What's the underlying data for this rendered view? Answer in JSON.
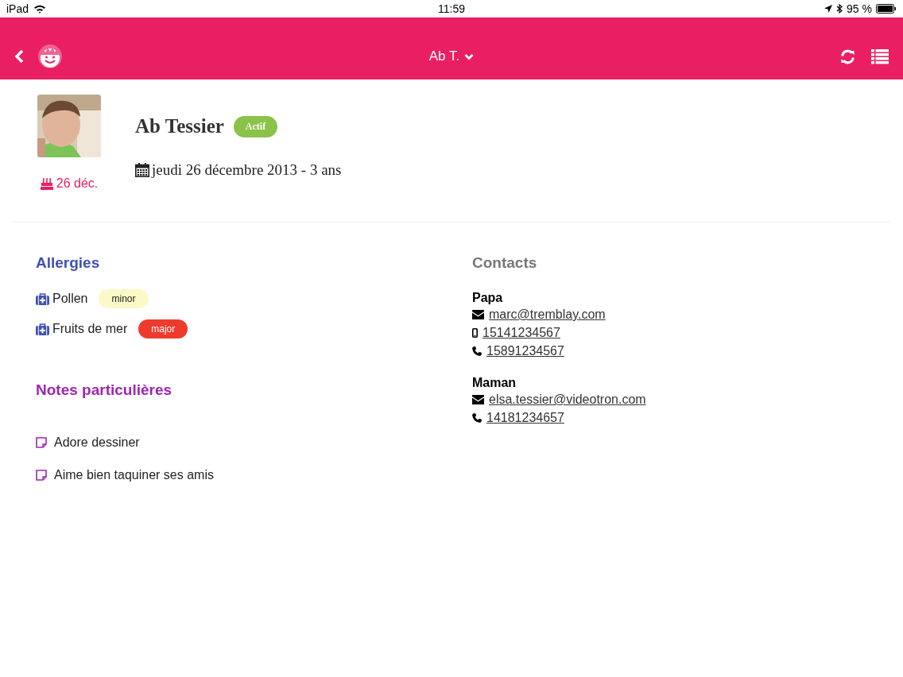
{
  "status_bar": {
    "device": "iPad",
    "time": "11:59",
    "battery": "95 %"
  },
  "header": {
    "title": "Ab T."
  },
  "profile": {
    "name": "Ab Tessier",
    "status": "Actif",
    "birthday": "26 déc.",
    "birthdate": "jeudi 26 décembre 2013 - 3 ans"
  },
  "allergies": {
    "title": "Allergies",
    "items": [
      {
        "name": "Pollen",
        "severity": "minor",
        "color": "#fbf9c6"
      },
      {
        "name": "Fruits de mer",
        "severity": "major",
        "color": "#ee3b2e"
      }
    ]
  },
  "notes": {
    "title": "Notes particulières",
    "items": [
      "Adore dessiner",
      "Aime bien taquiner ses amis"
    ]
  },
  "contacts": {
    "title": "Contacts",
    "groups": [
      {
        "name": "Papa",
        "entries": [
          {
            "kind": "email",
            "value": "marc@tremblay.com"
          },
          {
            "kind": "mobile",
            "value": "15141234567"
          },
          {
            "kind": "phone",
            "value": "15891234567"
          }
        ]
      },
      {
        "name": "Maman",
        "entries": [
          {
            "kind": "email",
            "value": "elsa.tessier@videotron.com"
          },
          {
            "kind": "phone",
            "value": "14181234657"
          }
        ]
      }
    ]
  }
}
